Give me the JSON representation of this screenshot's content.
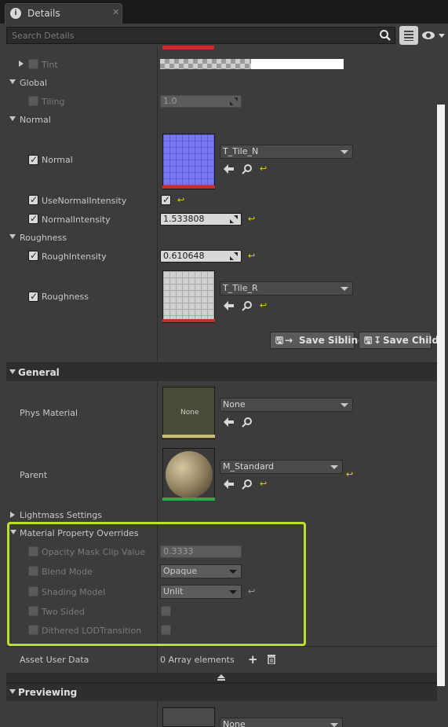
{
  "tab": {
    "title": "Details",
    "close": "✕"
  },
  "search": {
    "placeholder": "Search Details"
  },
  "rows": {
    "tint": "Tint",
    "global": "Global",
    "tiling_label": "Tiling",
    "tiling_value": "1.0",
    "normal_group": "Normal",
    "normal_label": "Normal",
    "normal_texture": "T_Tile_N",
    "use_normal_intensity": "UseNormalIntensity",
    "normal_intensity": "NormalIntensity",
    "normal_intensity_value": "1.533808",
    "roughness_group": "Roughness",
    "rough_intensity": "RoughIntensity",
    "rough_intensity_value": "0.610648",
    "roughness_label": "Roughness",
    "roughness_texture": "T_Tile_R"
  },
  "buttons": {
    "save_sibling": "Save Sibling",
    "save_child": "Save Child"
  },
  "general": {
    "title": "General",
    "phys_material": "Phys Material",
    "phys_thumb": "None",
    "phys_value": "None",
    "parent": "Parent",
    "parent_value": "M_Standard",
    "lightmass": "Lightmass Settings"
  },
  "overrides": {
    "title": "Material Property Overrides",
    "opacity_label": "Opacity Mask Clip Value",
    "opacity_value": "0.3333",
    "blend_label": "Blend Mode",
    "blend_value": "Opaque",
    "shading_label": "Shading Model",
    "shading_value": "Unlit",
    "two_sided": "Two Sided",
    "dithered": "Dithered LODTransition"
  },
  "asset_user_data": {
    "label": "Asset User Data",
    "value": "0 Array elements"
  },
  "previewing": {
    "title": "Previewing",
    "value": "None"
  },
  "colors": {
    "highlight": "#b9e12a",
    "reset_arrow": "#e8d800"
  }
}
